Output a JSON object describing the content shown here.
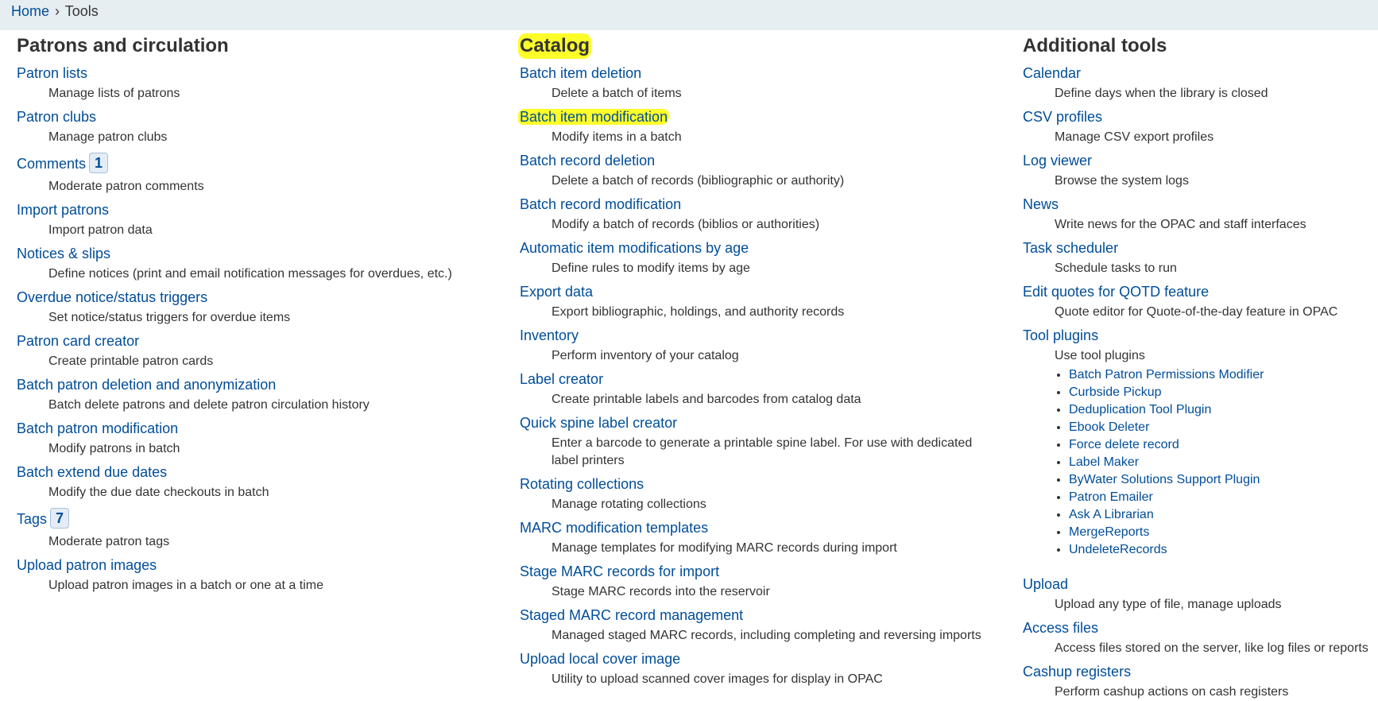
{
  "breadcrumb": {
    "home": "Home",
    "separator": "›",
    "current": "Tools"
  },
  "columns": {
    "patrons": {
      "title": "Patrons and circulation",
      "items": [
        {
          "label": "Patron lists",
          "desc": "Manage lists of patrons"
        },
        {
          "label": "Patron clubs",
          "desc": "Manage patron clubs"
        },
        {
          "label": "Comments",
          "badge": "1",
          "desc": "Moderate patron comments"
        },
        {
          "label": "Import patrons",
          "desc": "Import patron data"
        },
        {
          "label": "Notices & slips",
          "desc": "Define notices (print and email notification messages for overdues, etc.)"
        },
        {
          "label": "Overdue notice/status triggers",
          "desc": "Set notice/status triggers for overdue items"
        },
        {
          "label": "Patron card creator",
          "desc": "Create printable patron cards"
        },
        {
          "label": "Batch patron deletion and anonymization",
          "desc": "Batch delete patrons and delete patron circulation history"
        },
        {
          "label": "Batch patron modification",
          "desc": "Modify patrons in batch"
        },
        {
          "label": "Batch extend due dates",
          "desc": "Modify the due date checkouts in batch"
        },
        {
          "label": "Tags",
          "badge": "7",
          "desc": "Moderate patron tags"
        },
        {
          "label": "Upload patron images",
          "desc": "Upload patron images in a batch or one at a time"
        }
      ]
    },
    "catalog": {
      "title": "Catalog",
      "items": [
        {
          "label": "Batch item deletion",
          "desc": "Delete a batch of items"
        },
        {
          "label": "Batch item modification",
          "desc": "Modify items in a batch"
        },
        {
          "label": "Batch record deletion",
          "desc": "Delete a batch of records (bibliographic or authority)"
        },
        {
          "label": "Batch record modification",
          "desc": "Modify a batch of records (biblios or authorities)"
        },
        {
          "label": "Automatic item modifications by age",
          "desc": "Define rules to modify items by age"
        },
        {
          "label": "Export data",
          "desc": "Export bibliographic, holdings, and authority records"
        },
        {
          "label": "Inventory",
          "desc": "Perform inventory of your catalog"
        },
        {
          "label": "Label creator",
          "desc": "Create printable labels and barcodes from catalog data"
        },
        {
          "label": "Quick spine label creator",
          "desc": "Enter a barcode to generate a printable spine label. For use with dedicated label printers"
        },
        {
          "label": "Rotating collections",
          "desc": "Manage rotating collections"
        },
        {
          "label": "MARC modification templates",
          "desc": "Manage templates for modifying MARC records during import"
        },
        {
          "label": "Stage MARC records for import",
          "desc": "Stage MARC records into the reservoir"
        },
        {
          "label": "Staged MARC record management",
          "desc": "Managed staged MARC records, including completing and reversing imports"
        },
        {
          "label": "Upload local cover image",
          "desc": "Utility to upload scanned cover images for display in OPAC"
        }
      ]
    },
    "additional": {
      "title": "Additional tools",
      "items": [
        {
          "label": "Calendar",
          "desc": "Define days when the library is closed"
        },
        {
          "label": "CSV profiles",
          "desc": "Manage CSV export profiles"
        },
        {
          "label": "Log viewer",
          "desc": "Browse the system logs"
        },
        {
          "label": "News",
          "desc": "Write news for the OPAC and staff interfaces"
        },
        {
          "label": "Task scheduler",
          "desc": "Schedule tasks to run"
        },
        {
          "label": "Edit quotes for QOTD feature",
          "desc": "Quote editor for Quote-of-the-day feature in OPAC"
        },
        {
          "label": "Tool plugins",
          "desc": "Use tool plugins"
        }
      ],
      "plugins": [
        "Batch Patron Permissions Modifier",
        "Curbside Pickup",
        "Deduplication Tool Plugin",
        "Ebook Deleter",
        "Force delete record",
        "Label Maker",
        "ByWater Solutions Support Plugin",
        "Patron Emailer",
        "Ask A Librarian",
        "MergeReports",
        "UndeleteRecords"
      ],
      "items_after": [
        {
          "label": "Upload",
          "desc": "Upload any type of file, manage uploads"
        },
        {
          "label": "Access files",
          "desc": "Access files stored on the server, like log files or reports"
        },
        {
          "label": "Cashup registers",
          "desc": "Perform cashup actions on cash registers"
        }
      ]
    }
  },
  "highlight_color": "#fdfd2a",
  "link_color": "#004d99"
}
